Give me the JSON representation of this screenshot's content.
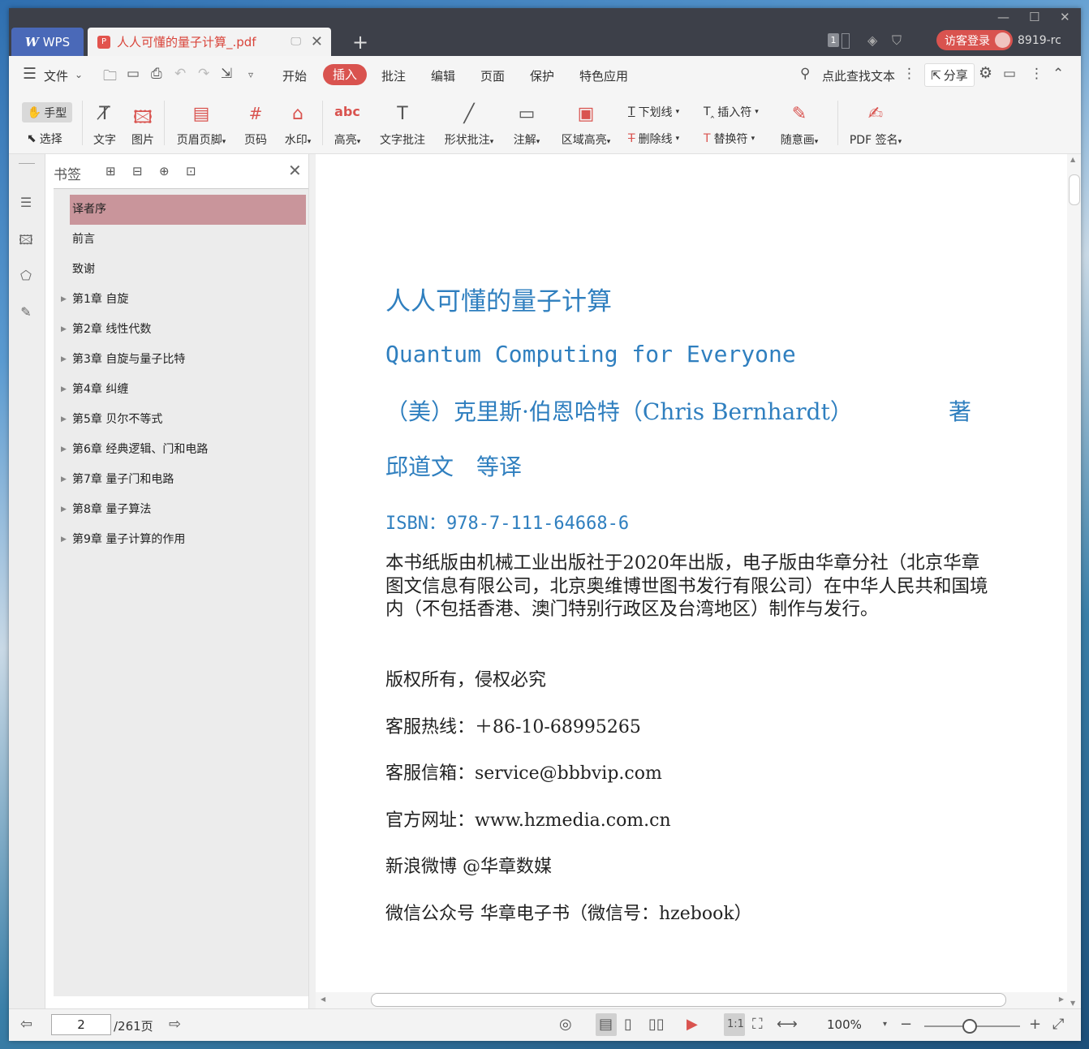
{
  "tabs": {
    "wps_label": "WPS",
    "doc_title": "人人可懂的量子计算_.pdf"
  },
  "titlebar": {
    "page_indicator": "1",
    "login_label": "访客登录",
    "user_id": "8919-rc"
  },
  "menu": {
    "file": "文件",
    "items": [
      "开始",
      "插入",
      "批注",
      "编辑",
      "页面",
      "保护",
      "特色应用"
    ],
    "active": "插入",
    "search_label": "点此查找文本",
    "share": "分享"
  },
  "toolbar": {
    "hand": "手型",
    "select": "选择",
    "text": "文字",
    "image": "图片",
    "header_footer": "页眉页脚",
    "page_num": "页码",
    "watermark": "水印",
    "highlight": "高亮",
    "text_note": "文字批注",
    "shape_note": "形状批注",
    "annotation": "注解",
    "area_highlight": "区域高亮",
    "underline": "下划线",
    "strikethrough": "删除线",
    "insert_mark": "插入符",
    "replace_mark": "替换符",
    "freehand": "随意画",
    "pdf_sign": "PDF 签名"
  },
  "bookmarks": {
    "title": "书签",
    "items": [
      {
        "label": "译者序",
        "selected": true
      },
      {
        "label": "前言"
      },
      {
        "label": "致谢"
      },
      {
        "label": "第1章 自旋"
      },
      {
        "label": "第2章 线性代数"
      },
      {
        "label": "第3章 自旋与量子比特"
      },
      {
        "label": "第4章 纠缠"
      },
      {
        "label": "第5章 贝尔不等式"
      },
      {
        "label": "第6章 经典逻辑、门和电路"
      },
      {
        "label": "第7章 量子门和电路"
      },
      {
        "label": "第8章 量子算法"
      },
      {
        "label": "第9章 量子计算的作用"
      }
    ]
  },
  "document": {
    "title_cn": "人人可懂的量子计算",
    "title_en": "Quantum Computing for Everyone",
    "author": "（美）克里斯·伯恩哈特（Chris Bernhardt）",
    "author_suffix": "著",
    "translator": "邱道文　等译",
    "isbn": "ISBN：978-7-111-64668-6",
    "publish_info": "本书纸版由机械工业出版社于2020年出版，电子版由华章分社（北京华章图文信息有限公司，北京奥维博世图书发行有限公司）在中华人民共和国境内（不包括香港、澳门特别行政区及台湾地区）制作与发行。",
    "copyright": "版权所有，侵权必究",
    "hotline": "客服热线：＋86-10-68995265",
    "email": "客服信箱：service@bbbvip.com",
    "website": "官方网址：www.hzmedia.com.cn",
    "weibo": "新浪微博 @华章数媒",
    "wechat": "微信公众号 华章电子书（微信号：hzebook）"
  },
  "status": {
    "current_page": "2",
    "total_pages": "/261页",
    "zoom": "100%"
  },
  "colors": {
    "accent": "#d9534f",
    "title_blue": "#2f7fbf",
    "bookmark_selected": "#c9959b"
  }
}
